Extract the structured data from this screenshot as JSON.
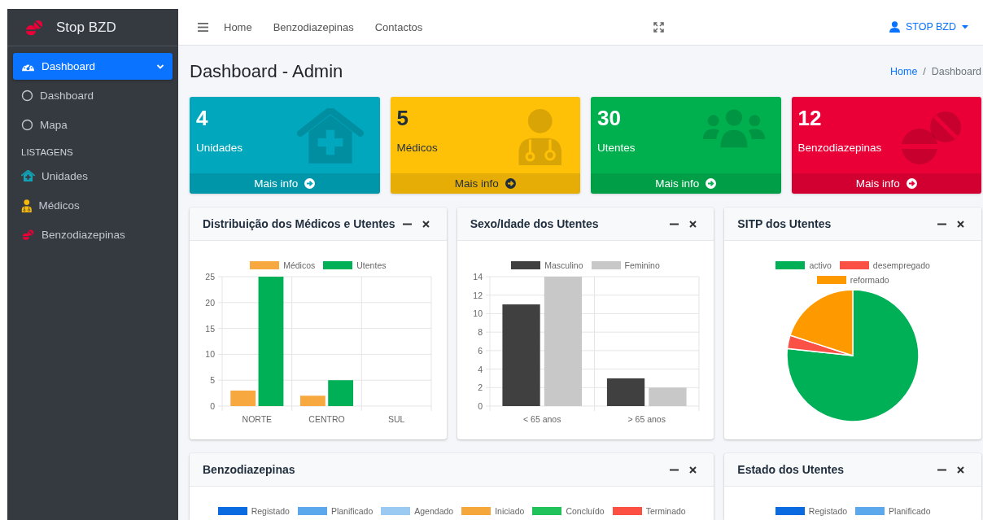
{
  "sidebar": {
    "brand": "Stop BZD",
    "items": [
      {
        "kind": "item",
        "label": "Dashboard",
        "selected": true,
        "expanded": true
      },
      {
        "kind": "subitem",
        "label": "Dashboard",
        "selected": false
      },
      {
        "kind": "subitem",
        "label": "Mapa",
        "selected": false
      },
      {
        "kind": "header",
        "label": "LISTAGENS"
      },
      {
        "kind": "item",
        "label": "Unidades",
        "selected": false
      },
      {
        "kind": "item",
        "label": "Médicos",
        "selected": false
      },
      {
        "kind": "item",
        "label": "Benzodiazepinas",
        "selected": false
      }
    ]
  },
  "navbar": {
    "links": [
      "Home",
      "Benzodiazepinas",
      "Contactos"
    ],
    "user": "STOP BZD"
  },
  "content_header": {
    "title": "Dashboard - Admin",
    "breadcrumb": [
      {
        "label": "Home",
        "link": true
      },
      {
        "label": "Dashboard",
        "link": false
      }
    ],
    "separator": "/"
  },
  "info_boxes": [
    {
      "value": "4",
      "label": "Unidades",
      "link": "Mais info",
      "color": "#00a7bd"
    },
    {
      "value": "5",
      "label": "Médicos",
      "link": "Mais info",
      "color": "#ffc107"
    },
    {
      "value": "30",
      "label": "Utentes",
      "link": "Mais info",
      "color": "#00b04f"
    },
    {
      "value": "12",
      "label": "Benzodiazepinas",
      "link": "Mais info",
      "color": "#ea0037"
    }
  ],
  "panels": [
    {
      "title": "Distribuição dos Médicos e Utentes",
      "chart_data": {
        "type": "bar",
        "categories": [
          "NORTE",
          "CENTRO",
          "SUL"
        ],
        "series": [
          {
            "name": "Médicos",
            "color": "#f7a83e",
            "values": [
              3,
              2,
              0
            ]
          },
          {
            "name": "Utentes",
            "color": "#00b057",
            "values": [
              25,
              5,
              0
            ]
          }
        ],
        "ylim": [
          0,
          25
        ],
        "yticks": [
          0,
          5,
          10,
          15,
          20,
          25
        ],
        "grid": true,
        "legend": true
      }
    },
    {
      "title": "Sexo/Idade dos Utentes",
      "chart_data": {
        "type": "bar",
        "categories": [
          "< 65 anos",
          "> 65 anos"
        ],
        "series": [
          {
            "name": "Masculino",
            "color": "#404040",
            "values": [
              11,
              3
            ]
          },
          {
            "name": "Feminino",
            "color": "#c8c8c8",
            "values": [
              14,
              2
            ]
          }
        ],
        "ylim": [
          0,
          14
        ],
        "yticks": [
          0,
          2,
          4,
          6,
          8,
          10,
          12,
          14
        ],
        "grid": true,
        "legend": true
      }
    },
    {
      "title": "SITP dos Utentes",
      "chart_data": {
        "type": "pie",
        "categories": [
          "activo",
          "desempregado",
          "reformado"
        ],
        "values": [
          76.7,
          3.3,
          20.0
        ],
        "colors": [
          "#00b057",
          "#fb5045",
          "#ff9900"
        ],
        "legend": true
      }
    },
    {
      "title": "Benzodiazepinas",
      "wide": true,
      "legend": [
        {
          "label": "Registado",
          "color": "#0a6adf"
        },
        {
          "label": "Planificado",
          "color": "#5ca8ec"
        },
        {
          "label": "Agendado",
          "color": "#9ac9f1"
        },
        {
          "label": "Iniciado",
          "color": "#f6a73b"
        },
        {
          "label": "Concluído",
          "color": "#20c25a"
        },
        {
          "label": "Terminado",
          "color": "#fb5042"
        }
      ]
    },
    {
      "title": "Estado dos Utentes",
      "wide": false,
      "legend": [
        {
          "label": "Registado",
          "color": "#0a6adf"
        },
        {
          "label": "Planificado",
          "color": "#5ca8ec"
        }
      ]
    }
  ]
}
